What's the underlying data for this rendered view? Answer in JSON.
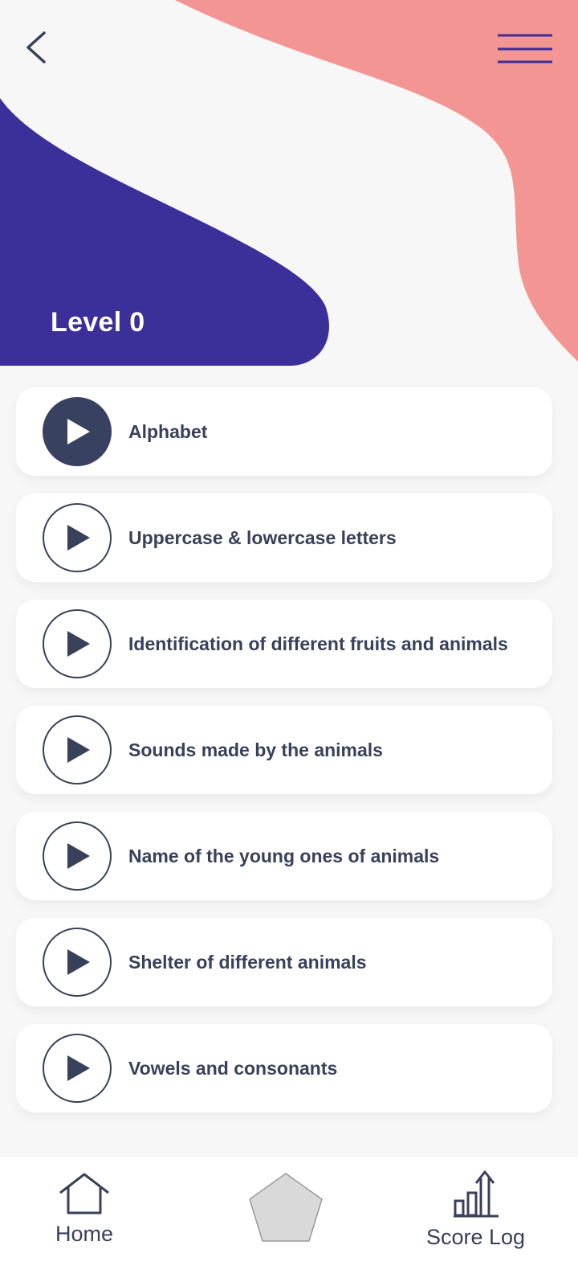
{
  "header": {
    "level_title": "Level 0",
    "back_icon": "chevron-left-icon",
    "menu_icon": "hamburger-menu-icon"
  },
  "colors": {
    "purple": "#3b2f9a",
    "coral": "#f39593",
    "dark": "#384260",
    "background": "#f7f7f7"
  },
  "lessons": [
    {
      "label": "Alphabet",
      "active": true
    },
    {
      "label": "Uppercase & lowercase letters",
      "active": false
    },
    {
      "label": "Identification of different fruits and animals",
      "active": false
    },
    {
      "label": "Sounds made by the animals",
      "active": false
    },
    {
      "label": "Name of the young ones of animals",
      "active": false
    },
    {
      "label": "Shelter of different animals",
      "active": false
    },
    {
      "label": "Vowels and consonants",
      "active": false
    }
  ],
  "bottom_nav": {
    "home_label": "Home",
    "score_label": "Score Log",
    "home_icon": "home-icon",
    "center_icon": "pentagon-icon",
    "score_icon": "bar-chart-up-icon"
  }
}
